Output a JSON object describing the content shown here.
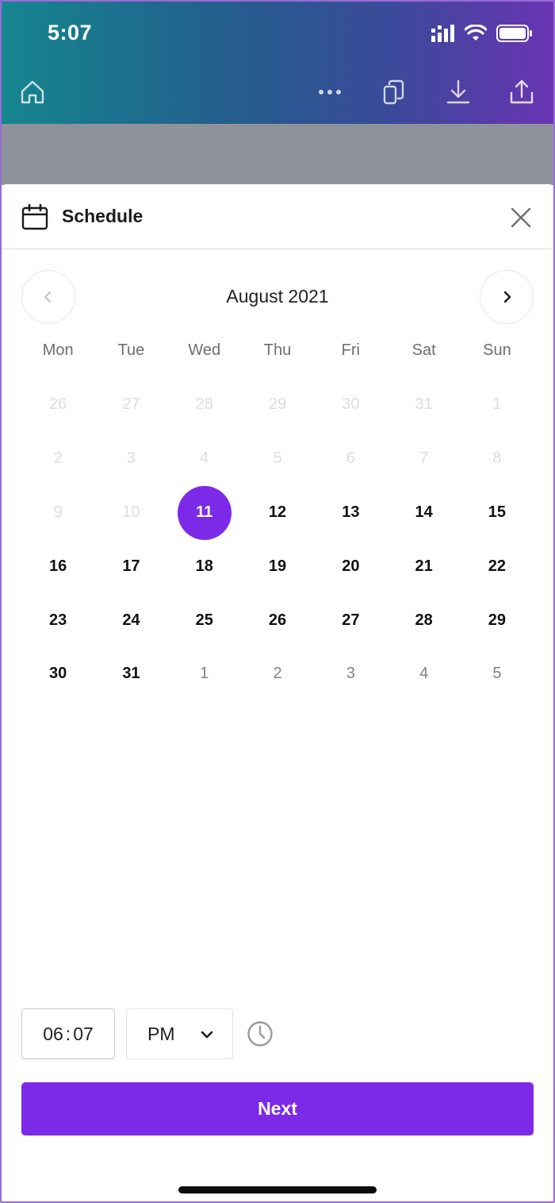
{
  "status_bar": {
    "time": "5:07"
  },
  "toolbar": {
    "icons": [
      "home-icon",
      "more-icon",
      "duplicate-icon",
      "download-icon",
      "share-icon"
    ]
  },
  "sheet": {
    "title": "Schedule",
    "icons": {
      "title": "calendar-icon",
      "close": "close-icon"
    }
  },
  "calendar": {
    "month_label": "August 2021",
    "weekdays": [
      "Mon",
      "Tue",
      "Wed",
      "Thu",
      "Fri",
      "Sat",
      "Sun"
    ],
    "selected_day": "11",
    "days": [
      {
        "label": "26",
        "state": "muted"
      },
      {
        "label": "27",
        "state": "muted"
      },
      {
        "label": "28",
        "state": "muted"
      },
      {
        "label": "29",
        "state": "muted"
      },
      {
        "label": "30",
        "state": "muted"
      },
      {
        "label": "31",
        "state": "muted"
      },
      {
        "label": "1",
        "state": "muted"
      },
      {
        "label": "2",
        "state": "muted"
      },
      {
        "label": "3",
        "state": "muted"
      },
      {
        "label": "4",
        "state": "muted"
      },
      {
        "label": "5",
        "state": "muted"
      },
      {
        "label": "6",
        "state": "muted"
      },
      {
        "label": "7",
        "state": "muted"
      },
      {
        "label": "8",
        "state": "muted"
      },
      {
        "label": "9",
        "state": "muted"
      },
      {
        "label": "10",
        "state": "muted"
      },
      {
        "label": "11",
        "state": "selected"
      },
      {
        "label": "12",
        "state": "active"
      },
      {
        "label": "13",
        "state": "active"
      },
      {
        "label": "14",
        "state": "active"
      },
      {
        "label": "15",
        "state": "active"
      },
      {
        "label": "16",
        "state": "active"
      },
      {
        "label": "17",
        "state": "active"
      },
      {
        "label": "18",
        "state": "active"
      },
      {
        "label": "19",
        "state": "active"
      },
      {
        "label": "20",
        "state": "active"
      },
      {
        "label": "21",
        "state": "active"
      },
      {
        "label": "22",
        "state": "active"
      },
      {
        "label": "23",
        "state": "active"
      },
      {
        "label": "24",
        "state": "active"
      },
      {
        "label": "25",
        "state": "active"
      },
      {
        "label": "26",
        "state": "active"
      },
      {
        "label": "27",
        "state": "active"
      },
      {
        "label": "28",
        "state": "active"
      },
      {
        "label": "29",
        "state": "active"
      },
      {
        "label": "30",
        "state": "active"
      },
      {
        "label": "31",
        "state": "active"
      },
      {
        "label": "1",
        "state": "next-month"
      },
      {
        "label": "2",
        "state": "next-month"
      },
      {
        "label": "3",
        "state": "next-month"
      },
      {
        "label": "4",
        "state": "next-month"
      },
      {
        "label": "5",
        "state": "next-month"
      }
    ]
  },
  "time_picker": {
    "hour": "06",
    "separator": ":",
    "minute": "07",
    "period": "PM"
  },
  "actions": {
    "next_label": "Next"
  },
  "colors": {
    "accent": "#7d2ae8",
    "header_gradient_start": "#15868f",
    "header_gradient_end": "#6a34b3"
  }
}
